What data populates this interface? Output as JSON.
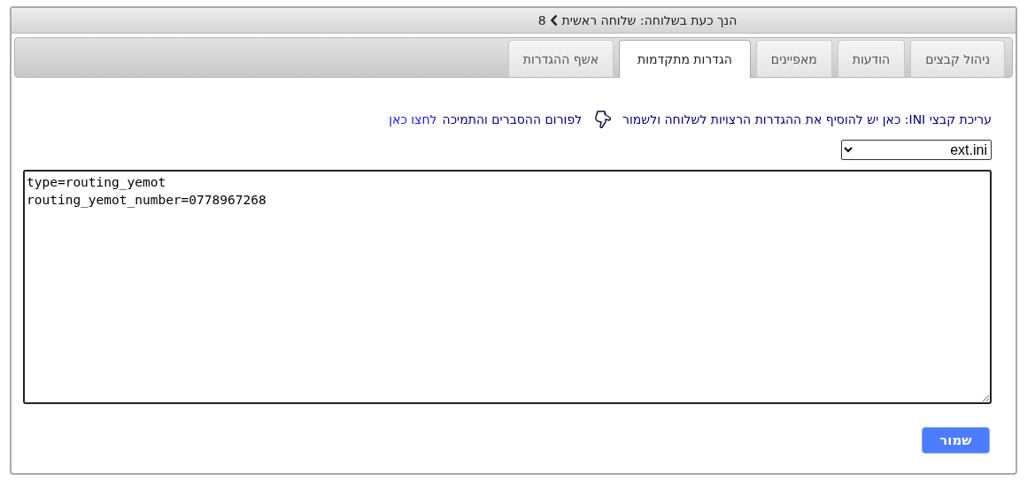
{
  "window": {
    "title": "הנך כעת בשלוחה: שלוחה ראשית",
    "extension": "8"
  },
  "tabs": [
    {
      "label": "ניהול קבצים",
      "selected": false
    },
    {
      "label": "הודעות",
      "selected": false
    },
    {
      "label": "מאפיינים",
      "selected": false
    },
    {
      "label": "הגדרות מתקדמות",
      "selected": true
    },
    {
      "label": "אשף ההגדרות",
      "selected": false
    }
  ],
  "instructions": {
    "text": "עריכת קבצי INI: כאן יש להוסיף את ההגדרות הרצויות לשלוחה ולשמור",
    "forum_text": "לפורום ההסברים והתמיכה",
    "link": "לחצו כאן"
  },
  "file_select": {
    "value": "ext.ini"
  },
  "editor": {
    "value": "type=routing_yemot\nrouting_yemot_number=0778967268"
  },
  "save_button": "שמור"
}
